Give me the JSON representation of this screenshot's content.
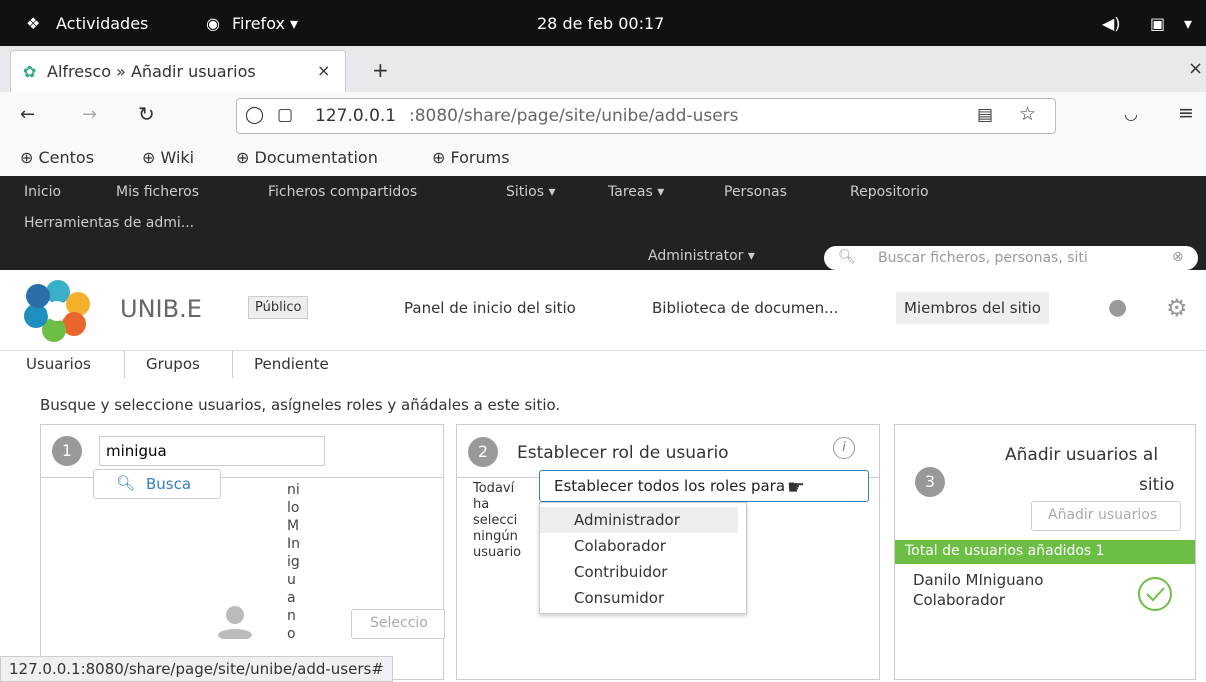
{
  "topbar": {
    "activities": "Actividades",
    "app": "Firefox ▾",
    "clock": "28 de feb  00:17"
  },
  "tab": {
    "title": "Alfresco » Añadir usuarios",
    "close": "×",
    "new": "+",
    "window_close": "×"
  },
  "nav": {
    "url_host": "127.0.0.1",
    "url_rest": ":8080/share/page/site/unibe/add-users"
  },
  "bookmarks": [
    "Centos",
    "Wiki",
    "Documentation",
    "Forums"
  ],
  "alf_nav": {
    "items": [
      "Inicio",
      "Mis ficheros",
      "Ficheros compartidos",
      "Sitios ▾",
      "Tareas ▾",
      "Personas",
      "Repositorio"
    ],
    "admin_tools": "Herramientas de admi...",
    "user_menu": "Administrator ▾",
    "search_placeholder": "Buscar ficheros, personas, siti"
  },
  "site": {
    "name": "UNIB.E",
    "visibility": "Público",
    "links": [
      "Panel de inicio del sitio",
      "Biblioteca de documen...",
      "Miembros del sitio"
    ]
  },
  "subnav": [
    "Usuarios",
    "Grupos",
    "Pendiente"
  ],
  "instructions": "Busque y seleccione usuarios, asígneles roles y añádales a este sitio.",
  "step1": {
    "num": "1",
    "search_value": "minigua",
    "search_button": "Busca",
    "result_name_letters": [
      "ni",
      "lo",
      "M",
      "In",
      "ig",
      "u",
      "a",
      "n",
      "o"
    ],
    "select_button": "Seleccio"
  },
  "step2": {
    "num": "2",
    "title": "Establecer rol de usuario",
    "set_all_button": "Establecer todos los roles para ▾",
    "empty_text": [
      "Todaví",
      "ha",
      "selecci",
      "ningún",
      "usuario"
    ],
    "roles": [
      "Administrador",
      "Colaborador",
      "Contribuidor",
      "Consumidor"
    ]
  },
  "step3": {
    "num": "3",
    "title_line1": "Añadir usuarios al",
    "title_line2": "sitio",
    "add_button": "Añadir usuarios",
    "total": "Total de usuarios añadidos 1",
    "user_name": "Danilo MIniguano",
    "user_role": "Colaborador"
  },
  "status_url": "127.0.0.1:8080/share/page/site/unibe/add-users#",
  "colors": {
    "accent_green": "#6cbe45",
    "header_dark": "#222222"
  }
}
